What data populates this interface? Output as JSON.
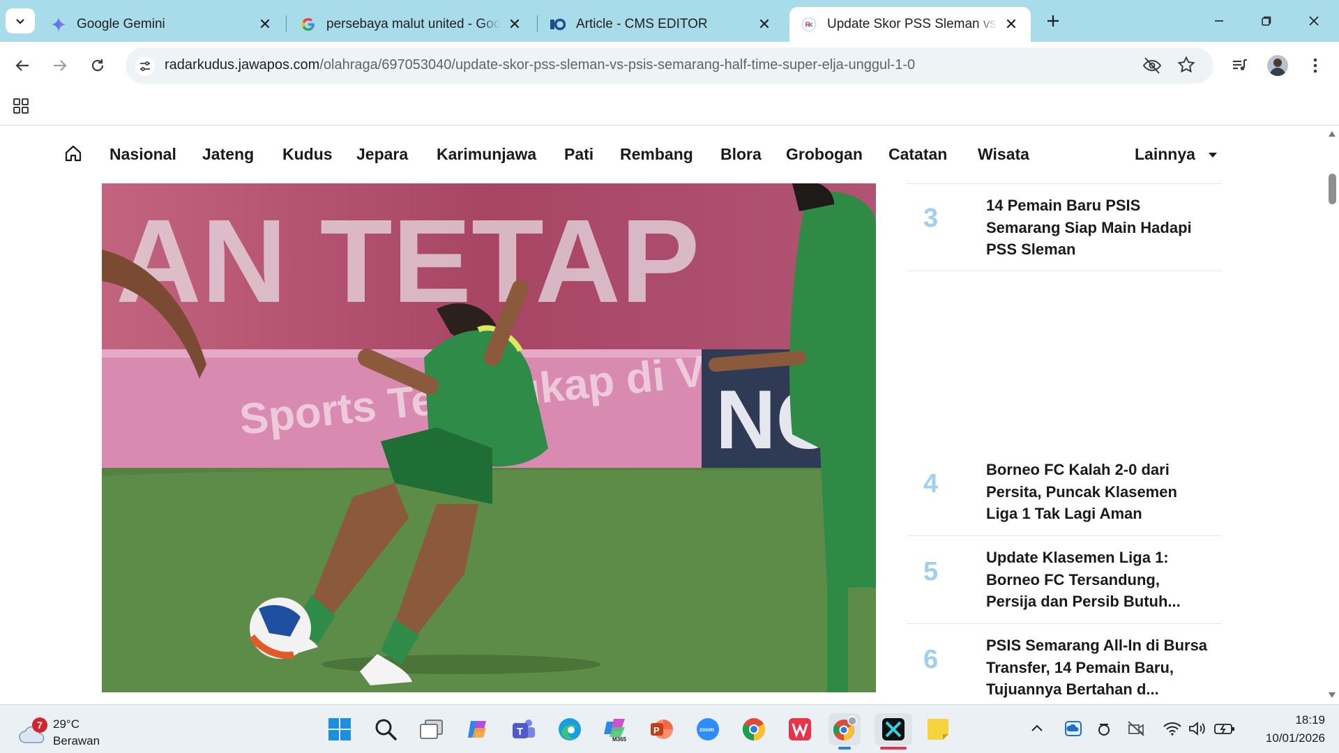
{
  "tabs": [
    {
      "title": "Google Gemini",
      "icon": "gemini-icon"
    },
    {
      "title": "persebaya malut united - Google",
      "icon": "google-icon"
    },
    {
      "title": "Article - CMS EDITOR",
      "icon": "cms-icon"
    },
    {
      "title": "Update Skor PSS Sleman vs PSIS",
      "icon": "radar-kudus-icon",
      "active": true
    }
  ],
  "address": {
    "domain": "radarkudus.jawapos.com",
    "path": "/olahraga/697053040/update-skor-pss-sleman-vs-psis-semarang-half-time-super-elja-unggul-1-0"
  },
  "site_nav": {
    "items": [
      "Nasional",
      "Jateng",
      "Kudus",
      "Jepara",
      "Karimunjawa",
      "Pati",
      "Rembang",
      "Blora",
      "Grobogan",
      "Catatan",
      "Wisata"
    ],
    "more": "Lainnya"
  },
  "ranking": [
    {
      "num": "3",
      "title": "14 Pemain Baru PSIS Semarang Siap Main Hadapi PSS Sleman"
    },
    {
      "num": "4",
      "title": "Borneo FC Kalah 2-0 dari Persita, Puncak Klasemen Liga 1 Tak Lagi Aman"
    },
    {
      "num": "5",
      "title": "Update Klasemen Liga 1: Borneo FC Tersandung, Persija dan Persib Butuh..."
    },
    {
      "num": "6",
      "title": "PSIS Semarang All-In di Bursa Transfer, 14 Pemain Baru, Tujuannya Bertahan d..."
    }
  ],
  "taskbar": {
    "weather": {
      "temp": "29°C",
      "desc": "Berawan",
      "badge": "7"
    },
    "time": "18:19",
    "date": "10/01/2026"
  },
  "colors": {
    "tabstrip": "#a8dcea",
    "rank_number": "#9fd0ef",
    "accent_red": "#e8334a"
  }
}
